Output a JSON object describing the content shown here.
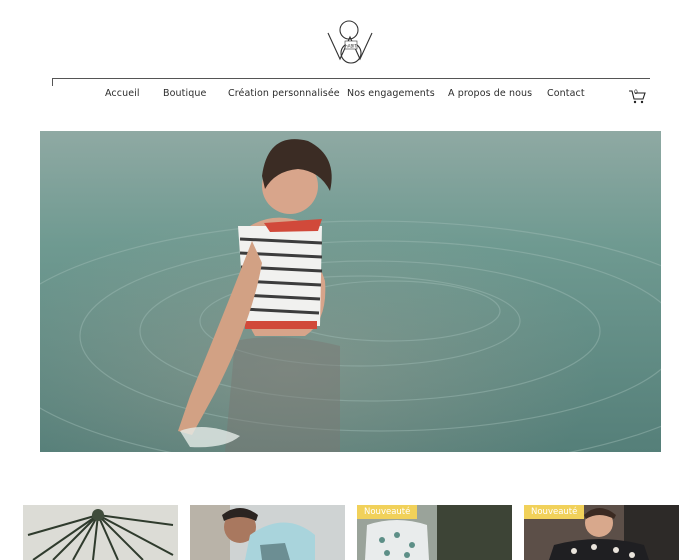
{
  "brand": {
    "logo_icon": "brand-monogram-logo",
    "logo_subtext": "hABIT"
  },
  "nav": {
    "items": [
      {
        "label": "Accueil"
      },
      {
        "label": "Boutique"
      },
      {
        "label": "Création personnalisée"
      },
      {
        "label": "Nos engagements"
      },
      {
        "label": "A propos de nous"
      },
      {
        "label": "Contact"
      }
    ]
  },
  "cart": {
    "icon": "cart-icon",
    "count": "0"
  },
  "hero": {
    "image": "woman-in-water-striped-top-photo"
  },
  "products": [
    {
      "image": "palm-leaves-photo",
      "badge": ""
    },
    {
      "image": "man-in-light-blue-hoodie-photo",
      "badge": ""
    },
    {
      "image": "printed-tshirt-photo",
      "badge": "Nouveauté"
    },
    {
      "image": "woman-in-floral-top-photo",
      "badge": "Nouveauté"
    }
  ],
  "colors": {
    "badge": "#f1d15a",
    "water": "#5f8f86"
  }
}
